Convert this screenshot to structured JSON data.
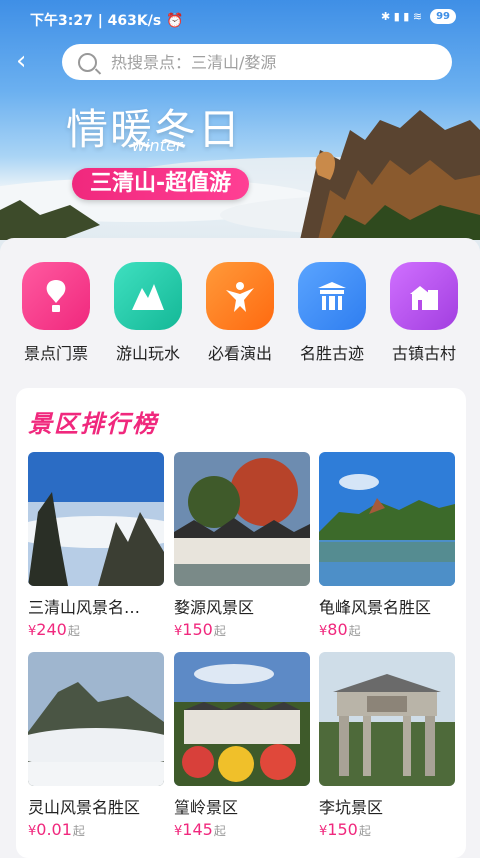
{
  "status_bar": {
    "left": "下午3:27 | 463K/s ⏰",
    "right_icons": "✱ ▮ ▮ ≋",
    "battery": "99"
  },
  "search": {
    "placeholder": "热搜景点：三清山/婺源"
  },
  "banner": {
    "title": "情暖冬日",
    "subtitle": "winter",
    "badge": "三清山-超值游"
  },
  "categories": [
    {
      "label": "景点门票",
      "icon": "hot-air-balloon-icon",
      "color": "#f0287d"
    },
    {
      "label": "游山玩水",
      "icon": "mountain-icon",
      "color": "#1fc7a8"
    },
    {
      "label": "必看演出",
      "icon": "dancer-icon",
      "color": "#ff7a1a"
    },
    {
      "label": "名胜古迹",
      "icon": "gate-icon",
      "color": "#3a86f0"
    },
    {
      "label": "古镇古村",
      "icon": "village-house-icon",
      "color": "#b54be8"
    }
  ],
  "ranking": {
    "title": "景区排行榜",
    "price_prefix": "¥",
    "price_suffix": "起",
    "items": [
      {
        "name": "三清山风景名…",
        "price": "240"
      },
      {
        "name": "婺源风景区",
        "price": "150"
      },
      {
        "name": "龟峰风景名胜区",
        "price": "80"
      },
      {
        "name": "灵山风景名胜区",
        "price": "0.01"
      },
      {
        "name": "篁岭景区",
        "price": "145"
      },
      {
        "name": "李坑景区",
        "price": "150"
      }
    ]
  },
  "colors": {
    "accent": "#f0287d",
    "sky": "#3f8fe6"
  }
}
